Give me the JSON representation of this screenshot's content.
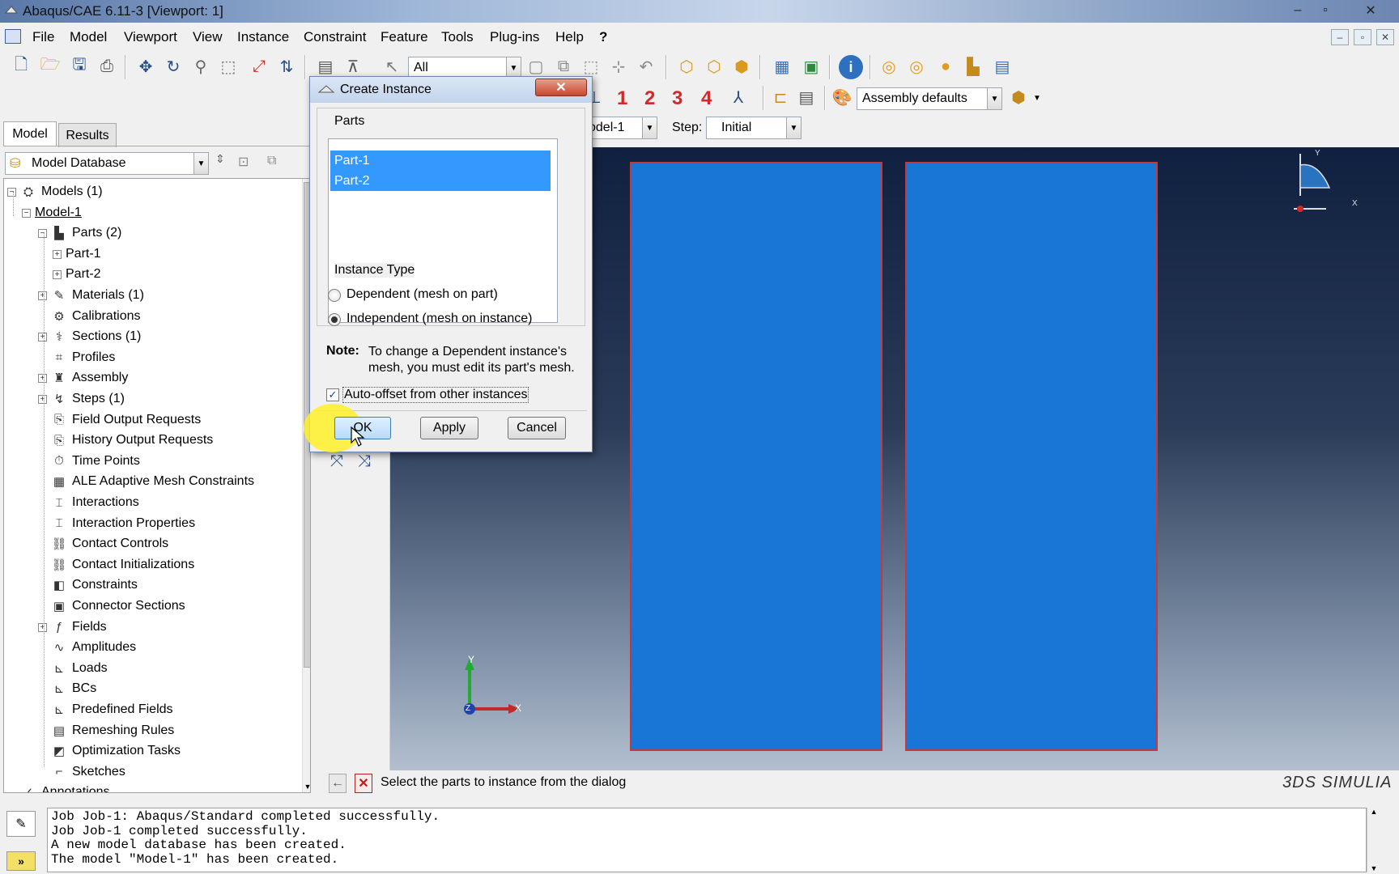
{
  "window": {
    "title": "Abaqus/CAE 6.11-3 [Viewport: 1]",
    "min": "–",
    "max": "▫",
    "close": "✕"
  },
  "menu": {
    "items": [
      "File",
      "Model",
      "Viewport",
      "View",
      "Instance",
      "Constraint",
      "Feature",
      "Tools",
      "Plug-ins",
      "Help",
      "?"
    ]
  },
  "toolbar": {
    "selection_filter": "All",
    "render_numbers": [
      "1",
      "2",
      "3",
      "4"
    ],
    "assembly_defaults": "Assembly defaults"
  },
  "context": {
    "model_label": "odel-1",
    "step_label": "Step:",
    "step_value": "Initial"
  },
  "left_panel": {
    "tabs": [
      "Model",
      "Results"
    ],
    "database": "Model Database",
    "tree": [
      {
        "label": "Models (1)",
        "level": 0,
        "expander": "−",
        "icon": "models-icon",
        "glyph": "⛭"
      },
      {
        "label": "Model-1",
        "level": 1,
        "expander": "−",
        "icon": "",
        "glyph": ""
      },
      {
        "label": "Parts (2)",
        "level": 2,
        "expander": "−",
        "icon": "parts-icon",
        "glyph": "▙"
      },
      {
        "label": "Part-1",
        "level": 3,
        "expander": "+",
        "icon": "",
        "glyph": ""
      },
      {
        "label": "Part-2",
        "level": 3,
        "expander": "+",
        "icon": "",
        "glyph": ""
      },
      {
        "label": "Materials (1)",
        "level": 2,
        "expander": "+",
        "icon": "materials-icon",
        "glyph": "✎"
      },
      {
        "label": "Calibrations",
        "level": 2,
        "expander": "",
        "icon": "calibrations-icon",
        "glyph": "⚙"
      },
      {
        "label": "Sections (1)",
        "level": 2,
        "expander": "+",
        "icon": "sections-icon",
        "glyph": "⚕"
      },
      {
        "label": "Profiles",
        "level": 2,
        "expander": "",
        "icon": "profiles-icon",
        "glyph": "⌗"
      },
      {
        "label": "Assembly",
        "level": 2,
        "expander": "+",
        "icon": "assembly-icon",
        "glyph": "♜"
      },
      {
        "label": "Steps (1)",
        "level": 2,
        "expander": "+",
        "icon": "steps-icon",
        "glyph": "↯"
      },
      {
        "label": "Field Output Requests",
        "level": 2,
        "expander": "",
        "icon": "field-output-icon",
        "glyph": "⎘"
      },
      {
        "label": "History Output Requests",
        "level": 2,
        "expander": "",
        "icon": "history-output-icon",
        "glyph": "⎘"
      },
      {
        "label": "Time Points",
        "level": 2,
        "expander": "",
        "icon": "time-points-icon",
        "glyph": "⏱"
      },
      {
        "label": "ALE Adaptive Mesh Constraints",
        "level": 2,
        "expander": "",
        "icon": "ale-icon",
        "glyph": "▦"
      },
      {
        "label": "Interactions",
        "level": 2,
        "expander": "",
        "icon": "interactions-icon",
        "glyph": "⌶"
      },
      {
        "label": "Interaction Properties",
        "level": 2,
        "expander": "",
        "icon": "interaction-properties-icon",
        "glyph": "⌶"
      },
      {
        "label": "Contact Controls",
        "level": 2,
        "expander": "",
        "icon": "contact-controls-icon",
        "glyph": "⛓"
      },
      {
        "label": "Contact Initializations",
        "level": 2,
        "expander": "",
        "icon": "contact-init-icon",
        "glyph": "⛓"
      },
      {
        "label": "Constraints",
        "level": 2,
        "expander": "",
        "icon": "constraints-icon",
        "glyph": "◧"
      },
      {
        "label": "Connector Sections",
        "level": 2,
        "expander": "",
        "icon": "connector-sections-icon",
        "glyph": "▣"
      },
      {
        "label": "Fields",
        "level": 2,
        "expander": "+",
        "icon": "fields-icon",
        "glyph": "ƒ"
      },
      {
        "label": "Amplitudes",
        "level": 2,
        "expander": "",
        "icon": "amplitudes-icon",
        "glyph": "∿"
      },
      {
        "label": "Loads",
        "level": 2,
        "expander": "",
        "icon": "loads-icon",
        "glyph": "⊾"
      },
      {
        "label": "BCs",
        "level": 2,
        "expander": "",
        "icon": "bcs-icon",
        "glyph": "⊾"
      },
      {
        "label": "Predefined Fields",
        "level": 2,
        "expander": "",
        "icon": "predefined-fields-icon",
        "glyph": "⊾"
      },
      {
        "label": "Remeshing Rules",
        "level": 2,
        "expander": "",
        "icon": "remeshing-icon",
        "glyph": "▤"
      },
      {
        "label": "Optimization Tasks",
        "level": 2,
        "expander": "",
        "icon": "optimization-icon",
        "glyph": "◩"
      },
      {
        "label": "Sketches",
        "level": 2,
        "expander": "",
        "icon": "sketches-icon",
        "glyph": "⌐"
      },
      {
        "label": "Annotations",
        "level": 0,
        "expander": "",
        "icon": "annotations-icon",
        "glyph": "✓"
      }
    ]
  },
  "dialog": {
    "title": "Create Instance",
    "close": "✕",
    "parts_label": "Parts",
    "parts": [
      "Part-1",
      "Part-2"
    ],
    "instance_type_label": "Instance Type",
    "option_dependent": "Dependent (mesh on part)",
    "option_independent": "Independent (mesh on instance)",
    "note_label": "Note:",
    "note_text": "To change a Dependent instance's mesh, you must edit its part's mesh.",
    "auto_offset": "Auto-offset from other instances",
    "ok": "OK",
    "apply": "Apply",
    "cancel": "Cancel"
  },
  "triad": {
    "y": "Y",
    "x": "X",
    "z": "Z"
  },
  "view_cube": {
    "y": "Y",
    "x": "X"
  },
  "prompt": {
    "text": "Select the parts to instance from the dialog"
  },
  "brand": "3DS SIMULIA",
  "messages": [
    "Job Job-1: Abaqus/Standard completed successfully.",
    "Job Job-1 completed successfully.",
    "A new model database has been created.",
    "The model \"Model-1\" has been created."
  ],
  "colors": {
    "part_fill": "#1a76d6",
    "part_edge": "#c23a3a",
    "selection": "#3399ff"
  }
}
